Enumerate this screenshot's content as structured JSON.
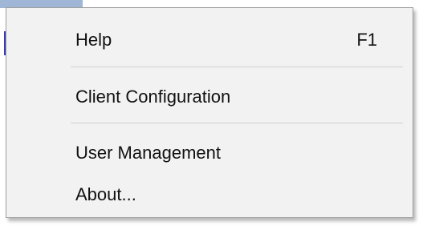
{
  "menu": {
    "items": [
      {
        "label": "Help",
        "shortcut": "F1"
      },
      {
        "label": "Client Configuration",
        "shortcut": ""
      },
      {
        "label": "User Management",
        "shortcut": ""
      },
      {
        "label": "About...",
        "shortcut": ""
      }
    ]
  },
  "colors": {
    "menu_background": "#f2f2f2",
    "menu_border": "#a0a0a0",
    "separator": "#d0d0d0",
    "text": "#111111",
    "top_strip": "#9fb6d6",
    "left_accent": "#3b3bbd"
  }
}
